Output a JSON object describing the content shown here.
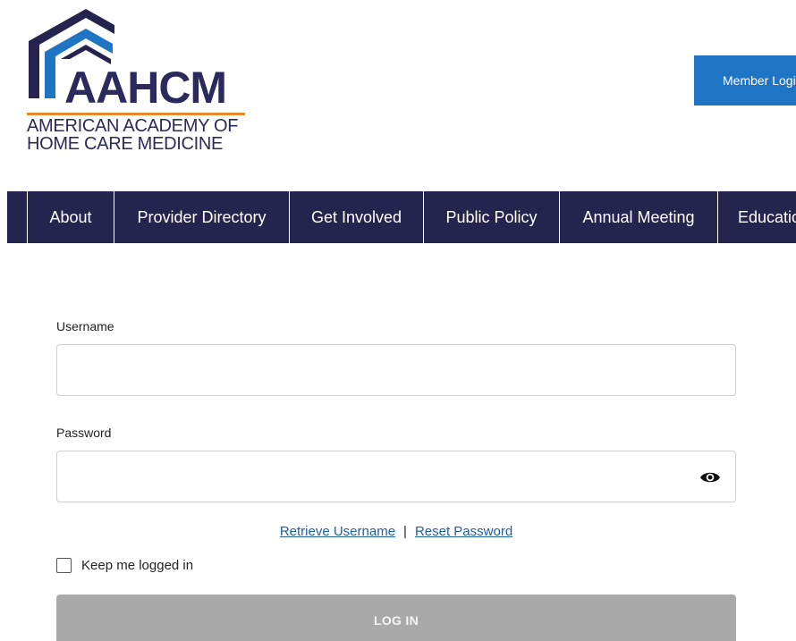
{
  "logo": {
    "wordmark": "AAHCM",
    "line1": "AMERICAN ACADEMY OF",
    "line2": "HOME CARE MEDICINE",
    "colors": {
      "navy": "#2a2a5c",
      "blue": "#1f74c4",
      "orange": "#e8892c"
    }
  },
  "header": {
    "member_login_label": "Member Login"
  },
  "nav": {
    "items": [
      {
        "label": "About"
      },
      {
        "label": "Provider Directory"
      },
      {
        "label": "Get Involved"
      },
      {
        "label": "Public Policy"
      },
      {
        "label": "Annual Meeting"
      },
      {
        "label": "Education"
      }
    ]
  },
  "form": {
    "username_label": "Username",
    "username_value": "",
    "password_label": "Password",
    "password_value": "",
    "password_toggle_icon": "eye-icon",
    "retrieve_username": "Retrieve Username",
    "separator": "|",
    "reset_password": "Reset Password",
    "keep_logged_in": "Keep me logged in",
    "keep_logged_in_checked": false,
    "login_label": "LOG IN"
  }
}
